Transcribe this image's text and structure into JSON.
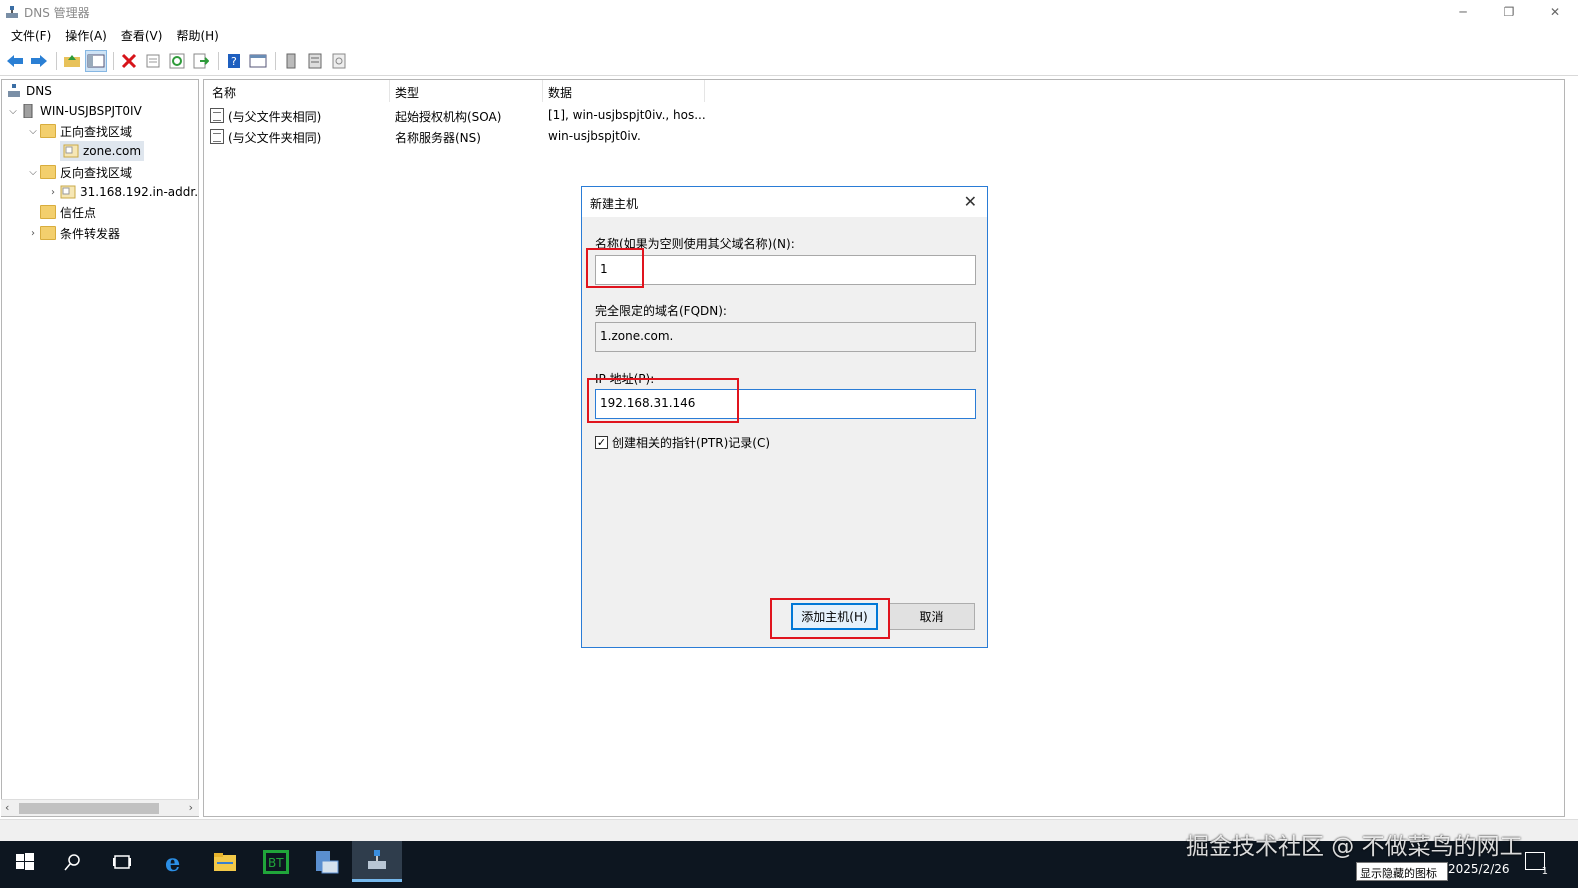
{
  "window": {
    "title": "DNS 管理器",
    "controls": {
      "minimize": "─",
      "restore": "❐",
      "close": "✕"
    }
  },
  "menu": [
    "文件(F)",
    "操作(A)",
    "查看(V)",
    "帮助(H)"
  ],
  "toolbar": {
    "icons": [
      "back-arrow",
      "forward-arrow",
      "up-folder",
      "show-hide-tree",
      "delete",
      "properties",
      "refresh",
      "export-list",
      "help",
      "mmc-view",
      "server",
      "list",
      "update"
    ]
  },
  "tree": {
    "root": "DNS",
    "server": "WIN-USJBSPJT0IV",
    "forward": "正向查找区域",
    "forward_zone": "zone.com",
    "reverse": "反向查找区域",
    "reverse_zone": "31.168.192.in-addr.",
    "trust_points": "信任点",
    "conditional_forwarders": "条件转发器"
  },
  "list": {
    "columns": [
      "名称",
      "类型",
      "数据"
    ],
    "rows": [
      {
        "name": "(与父文件夹相同)",
        "type": "起始授权机构(SOA)",
        "data": "[1], win-usjbspjt0iv., hos..."
      },
      {
        "name": "(与父文件夹相同)",
        "type": "名称服务器(NS)",
        "data": "win-usjbspjt0iv."
      }
    ]
  },
  "dialog": {
    "title": "新建主机",
    "close": "✕",
    "name_label": "名称(如果为空则使用其父域名称)(N):",
    "name_value": "1",
    "fqdn_label": "完全限定的域名(FQDN):",
    "fqdn_value": "1.zone.com.",
    "ip_label": "IP 地址(P):",
    "ip_value": "192.168.31.146",
    "ptr_label": "创建相关的指针(PTR)记录(C)",
    "ptr_checked": true,
    "add_button": "添加主机(H)",
    "cancel_button": "取消"
  },
  "taskbar": {
    "watermark": "掘金技术社区 @ 不做菜鸟的网工",
    "tooltip": "显示隐藏的图标",
    "date": "2025/2/26",
    "notif_count": "1"
  },
  "colors": {
    "accent": "#0078d7",
    "highlight": "#e0141e",
    "taskbar": "#0d1620"
  }
}
